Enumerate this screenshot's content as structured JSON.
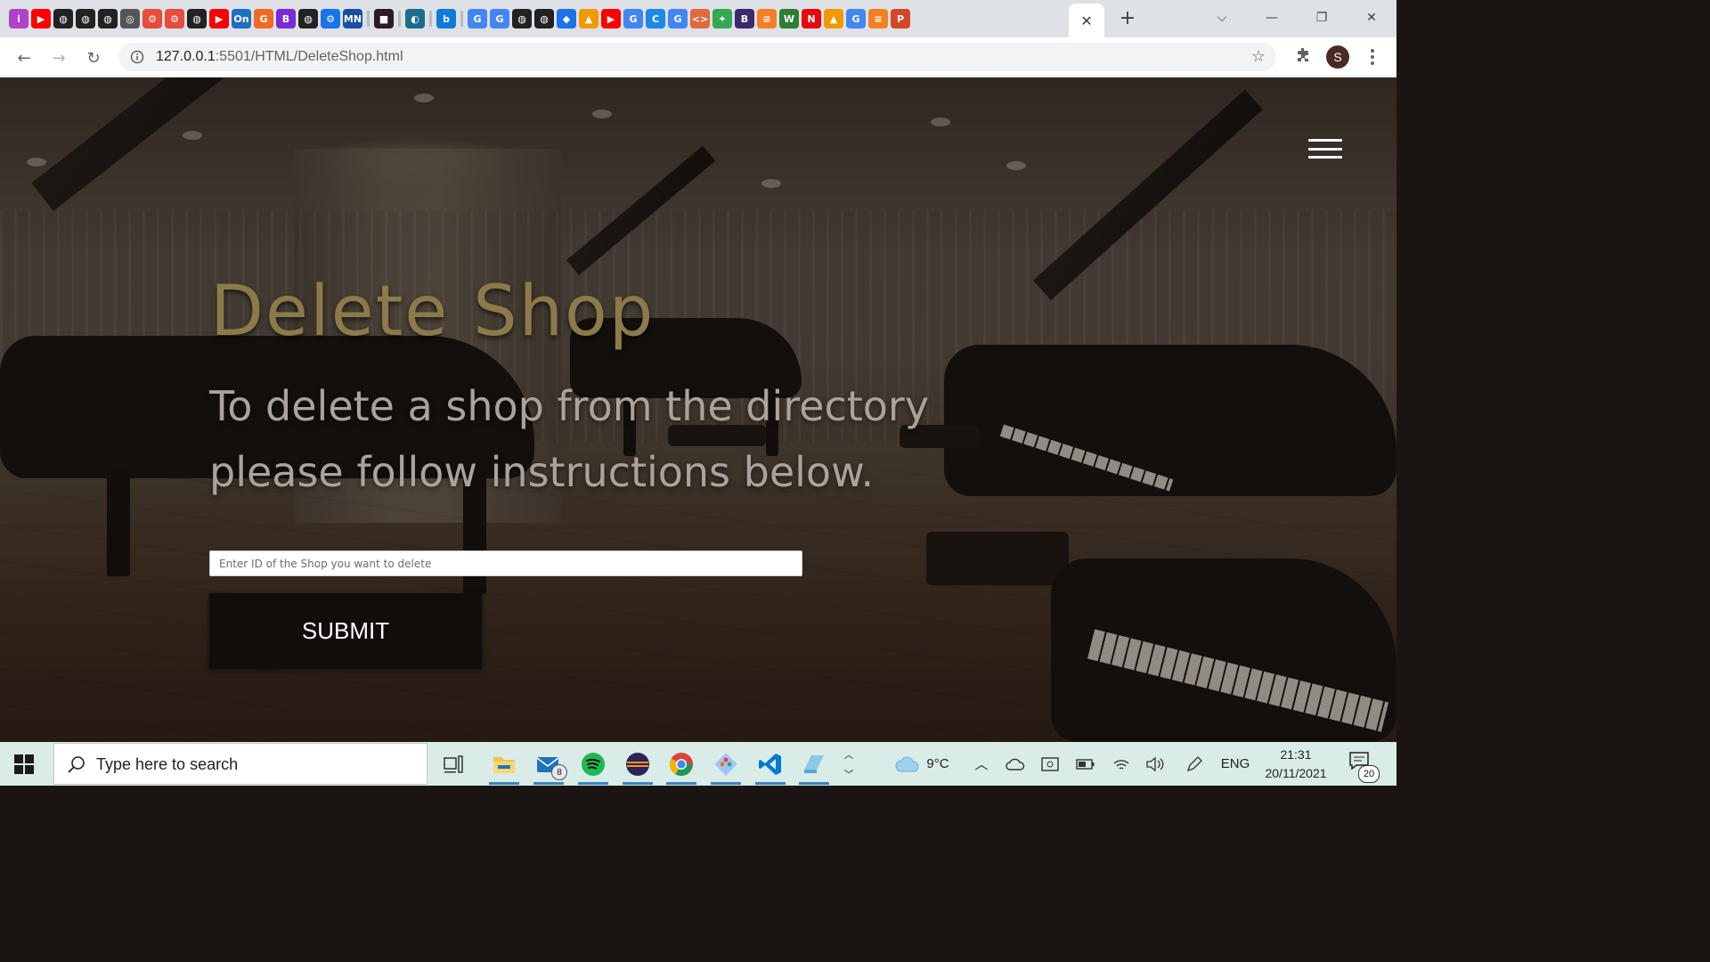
{
  "browser": {
    "tab_favicons": [
      {
        "icon": "instagram-icon",
        "color": "#b042c8",
        "glyph": "i"
      },
      {
        "icon": "youtube-icon",
        "color": "#ff0000",
        "glyph": "▶"
      },
      {
        "icon": "github-icon",
        "color": "#222222",
        "glyph": "◍"
      },
      {
        "icon": "github-icon",
        "color": "#222222",
        "glyph": "◍"
      },
      {
        "icon": "github-icon",
        "color": "#222222",
        "glyph": "◍"
      },
      {
        "icon": "globe-icon",
        "color": "#555555",
        "glyph": "◎"
      },
      {
        "icon": "openai-icon",
        "color": "#e74c3c",
        "glyph": "⚙"
      },
      {
        "icon": "openai-icon",
        "color": "#e74c3c",
        "glyph": "⚙"
      },
      {
        "icon": "github-icon",
        "color": "#222222",
        "glyph": "◍"
      },
      {
        "icon": "youtube-icon",
        "color": "#ff0000",
        "glyph": "▶"
      },
      {
        "icon": "onshape-icon",
        "color": "#1f6fc0",
        "glyph": "On"
      },
      {
        "icon": "g-icon",
        "color": "#f26a21",
        "glyph": "G"
      },
      {
        "icon": "b-icon",
        "color": "#7a2bd6",
        "glyph": "B"
      },
      {
        "icon": "github-icon",
        "color": "#222222",
        "glyph": "◍"
      },
      {
        "icon": "gear-icon",
        "color": "#1a73e8",
        "glyph": "⚙"
      },
      {
        "icon": "mdn-icon",
        "color": "#1a4fa0",
        "glyph": "MN"
      },
      {
        "icon": "separator",
        "color": "",
        "glyph": ""
      },
      {
        "icon": "square-icon",
        "color": "#2d1b22",
        "glyph": "■"
      },
      {
        "icon": "separator",
        "color": "",
        "glyph": ""
      },
      {
        "icon": "edge-icon",
        "color": "#1b6e8a",
        "glyph": "◐"
      },
      {
        "icon": "separator",
        "color": "",
        "glyph": ""
      },
      {
        "icon": "bing-icon",
        "color": "#0f7bd6",
        "glyph": "b"
      },
      {
        "icon": "separator",
        "color": "",
        "glyph": ""
      },
      {
        "icon": "google-icon",
        "color": "#4285f4",
        "glyph": "G"
      },
      {
        "icon": "google-icon",
        "color": "#4285f4",
        "glyph": "G"
      },
      {
        "icon": "github-icon",
        "color": "#222222",
        "glyph": "◍"
      },
      {
        "icon": "github-icon",
        "color": "#222222",
        "glyph": "◍"
      },
      {
        "icon": "diamond-icon",
        "color": "#1a73e8",
        "glyph": "◆"
      },
      {
        "icon": "puzzle-icon",
        "color": "#f29900",
        "glyph": "▲"
      },
      {
        "icon": "youtube-icon",
        "color": "#ff0000",
        "glyph": "▶"
      },
      {
        "icon": "google-icon",
        "color": "#4285f4",
        "glyph": "G"
      },
      {
        "icon": "c-icon",
        "color": "#1e88e5",
        "glyph": "C"
      },
      {
        "icon": "google-icon",
        "color": "#4285f4",
        "glyph": "G"
      },
      {
        "icon": "code-icon",
        "color": "#e06a3a",
        "glyph": "<>"
      },
      {
        "icon": "colorful-icon",
        "color": "#34a853",
        "glyph": "✦"
      },
      {
        "icon": "b-icon",
        "color": "#3b2a6e",
        "glyph": "B"
      },
      {
        "icon": "stackoverflow-icon",
        "color": "#f48024",
        "glyph": "≡"
      },
      {
        "icon": "w-icon",
        "color": "#2e7d32",
        "glyph": "W"
      },
      {
        "icon": "netflix-icon",
        "color": "#e50914",
        "glyph": "N"
      },
      {
        "icon": "puzzle-icon",
        "color": "#f29900",
        "glyph": "▲"
      },
      {
        "icon": "google-icon",
        "color": "#4285f4",
        "glyph": "G"
      },
      {
        "icon": "stackoverflow-icon",
        "color": "#f48024",
        "glyph": "≡"
      },
      {
        "icon": "powerpoint-icon",
        "color": "#d24726",
        "glyph": "P"
      }
    ],
    "close_tab_glyph": "✕",
    "new_tab_glyph": "+",
    "tab_list_glyph": "⌵",
    "minimize_glyph": "—",
    "restore_glyph": "❐",
    "close_window_glyph": "✕",
    "back_glyph": "←",
    "forward_glyph": "→",
    "reload_glyph": "↻",
    "url_host": "127.0.0.1",
    "url_path": ":5501/HTML/DeleteShop.html",
    "bookmark_glyph": "☆",
    "profile_initial": "S"
  },
  "page": {
    "title": "Delete Shop",
    "subtitle": "To delete a shop from the directory please follow instructions below.",
    "input_placeholder": "Enter ID of the Shop you want to delete",
    "input_value": "",
    "submit_label": "SUBMIT",
    "colors": {
      "title": "#8d7a4a",
      "subtitle": "#a9a39c",
      "button_bg": "#120d0b"
    }
  },
  "taskbar": {
    "search_placeholder": "Type here to search",
    "apps": [
      {
        "name": "task-view-icon",
        "glyph": "⧉"
      },
      {
        "name": "file-explorer-icon",
        "glyph": "📁"
      },
      {
        "name": "mail-icon",
        "glyph": "✉",
        "badge": "8"
      },
      {
        "name": "spotify-icon",
        "glyph": "◉"
      },
      {
        "name": "eclipse-icon",
        "glyph": "◓"
      },
      {
        "name": "chrome-icon",
        "glyph": "◕"
      },
      {
        "name": "git-icon",
        "glyph": "◆"
      },
      {
        "name": "vscode-icon",
        "glyph": "◥"
      },
      {
        "name": "notepad-icon",
        "glyph": "▱"
      }
    ],
    "weather": "9°C",
    "language": "ENG",
    "time": "21:31",
    "date": "20/11/2021",
    "notification_count": "20"
  }
}
